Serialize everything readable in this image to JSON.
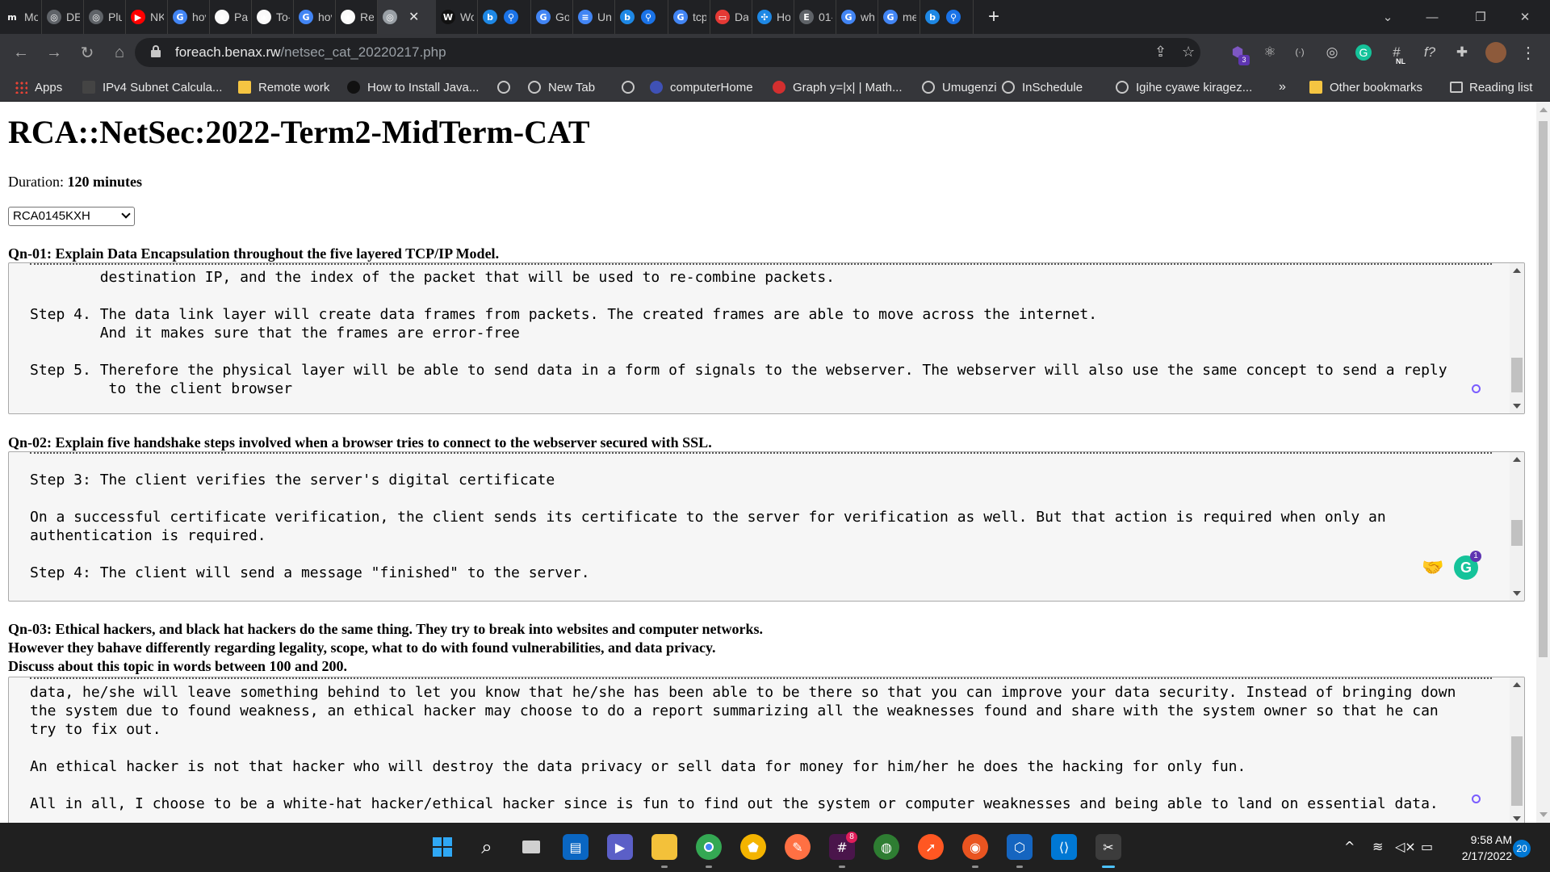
{
  "browser": {
    "tabs": [
      {
        "label": "Mo",
        "icon": "m-icon",
        "icon_text": "m",
        "color": "#202124"
      },
      {
        "label": "DE",
        "icon": "dev-icon",
        "icon_text": "◎",
        "color": "#5f6368"
      },
      {
        "label": "Plu",
        "icon": "globe-icon",
        "icon_text": "◎",
        "color": "#5f6368"
      },
      {
        "label": "NK",
        "icon": "youtube-icon",
        "icon_text": "▶",
        "color": "#ff0000"
      },
      {
        "label": "hov",
        "icon": "google-icon",
        "icon_text": "G",
        "color": "#4285f4"
      },
      {
        "label": "Pat",
        "icon": "github-icon",
        "icon_text": "◉",
        "color": "#fafafa"
      },
      {
        "label": "To-",
        "icon": "github-icon",
        "icon_text": "◉",
        "color": "#fafafa"
      },
      {
        "label": "hov",
        "icon": "google-icon",
        "icon_text": "G",
        "color": "#4285f4"
      },
      {
        "label": "Rel",
        "icon": "github-icon",
        "icon_text": "◉",
        "color": "#fafafa"
      },
      {
        "label": "",
        "icon": "globe-icon",
        "icon_text": "◎",
        "color": "#9aa0a6",
        "active": true
      },
      {
        "label": "Wo",
        "icon": "w-icon",
        "icon_text": "W",
        "color": "#111111"
      },
      {
        "label": "",
        "icon": "bing-icon",
        "icon_text": "b",
        "color": "#1e88e5",
        "double": true
      },
      {
        "label": "Go",
        "icon": "google-icon",
        "icon_text": "G",
        "color": "#4285f4"
      },
      {
        "label": "Un",
        "icon": "docs-icon",
        "icon_text": "≡",
        "color": "#4285f4"
      },
      {
        "label": "",
        "icon": "bing-icon",
        "icon_text": "b",
        "color": "#1e88e5",
        "double": true
      },
      {
        "label": "tcp",
        "icon": "google-icon",
        "icon_text": "G",
        "color": "#4285f4"
      },
      {
        "label": "Dat",
        "icon": "oracle-icon",
        "icon_text": "▭",
        "color": "#e53935"
      },
      {
        "label": "Hor",
        "icon": "hub-icon",
        "icon_text": "✣",
        "color": "#1e88e5"
      },
      {
        "label": "01-",
        "icon": "e-icon",
        "icon_text": "E",
        "color": "#5f6368"
      },
      {
        "label": "wh",
        "icon": "google-icon",
        "icon_text": "G",
        "color": "#4285f4"
      },
      {
        "label": "me",
        "icon": "google-icon",
        "icon_text": "G",
        "color": "#4285f4"
      },
      {
        "label": "",
        "icon": "bing-icon",
        "icon_text": "b",
        "color": "#1e88e5",
        "double": true
      }
    ],
    "url_host": "foreach.benax.rw",
    "url_path": "/netsec_cat_20220217.php",
    "bookmarks": [
      {
        "label": "Apps",
        "icon": "apps-grid-icon"
      },
      {
        "label": "IPv4 Subnet Calcula...",
        "icon": "n-icon"
      },
      {
        "label": "Remote work",
        "icon": "folder-icon"
      },
      {
        "label": "How to Install Java...",
        "icon": "hex-icon"
      },
      {
        "label": "",
        "icon": "globe-icon"
      },
      {
        "label": "New Tab",
        "icon": "globe-icon"
      },
      {
        "label": "",
        "icon": "globe-icon"
      },
      {
        "label": "computerHome",
        "icon": "feather-icon"
      },
      {
        "label": "Graph y=|x| | Math...",
        "icon": "m-icon"
      },
      {
        "label": "Umugenzi",
        "icon": "globe-icon"
      },
      {
        "label": "InSchedule",
        "icon": "globe-icon"
      },
      {
        "label": "Igihe cyawe kiragez...",
        "icon": "globe-icon"
      }
    ],
    "bookmarks_overflow": "»",
    "other_bookmarks": "Other bookmarks",
    "reading_list": "Reading list",
    "extension_badges": {
      "notifications": "3",
      "lang": "NL"
    }
  },
  "page": {
    "title": "RCA::NetSec:2022-Term2-MidTerm-CAT",
    "duration_label": "Duration:",
    "duration_value": "120 minutes",
    "student_selected": "RCA0145KXH",
    "q1": {
      "prompt": "Qn-01: Explain Data Encapsulation throughout the five layered TCP/IP Model.",
      "answer": "        destination IP, and the index of the packet that will be used to re-combine packets.\n\nStep 4. The data link layer will create data frames from packets. The created frames are able to move across the internet.\n        And it makes sure that the frames are error-free\n\nStep 5. Therefore the physical layer will be able to send data in a form of signals to the webserver. The webserver will also use the same concept to send a reply\n         to the client browser"
    },
    "q2": {
      "prompt": "Qn-02: Explain five handshake steps involved when a browser tries to connect to the webserver secured with SSL.",
      "answer": "\nStep 3: The client verifies the server's digital certificate\n\nOn a successful certificate verification, the client sends its certificate to the server for verification as well. But that action is required when only an\nauthentication is required.\n\nStep 4: The client will send a message \"finished\" to the server."
    },
    "q3": {
      "prompt_line1": "Qn-03: Ethical hackers, and black hat hackers do the same thing. They try to break into websites and computer networks.",
      "prompt_line2": "However they bahave differently regarding legality, scope, what to do with found vulnerabilities, and data privacy.",
      "prompt_line3": "Discuss about this topic in words between 100 and 200.",
      "answer": "data, he/she will leave something behind to let you know that he/she has been able to be there so that you can improve your data security. Instead of bringing down\nthe system due to found weakness, an ethical hacker may choose to do a report summarizing all the weaknesses found and share with the system owner so that he can\ntry to fix out.\n\nAn ethical hacker is not that hacker who will destroy the data privacy or sell data for money for him/her he does the hacking for only fun.\n\nAll in all, I choose to be a white-hat hacker/ethical hacker since is fun to find out the system or computer weaknesses and being able to land on essential data."
    },
    "grammarly_badge": "1"
  },
  "taskbar": {
    "time": "9:58 AM",
    "date": "2/17/2022",
    "notification_count": "20",
    "slack_badge": "8"
  }
}
